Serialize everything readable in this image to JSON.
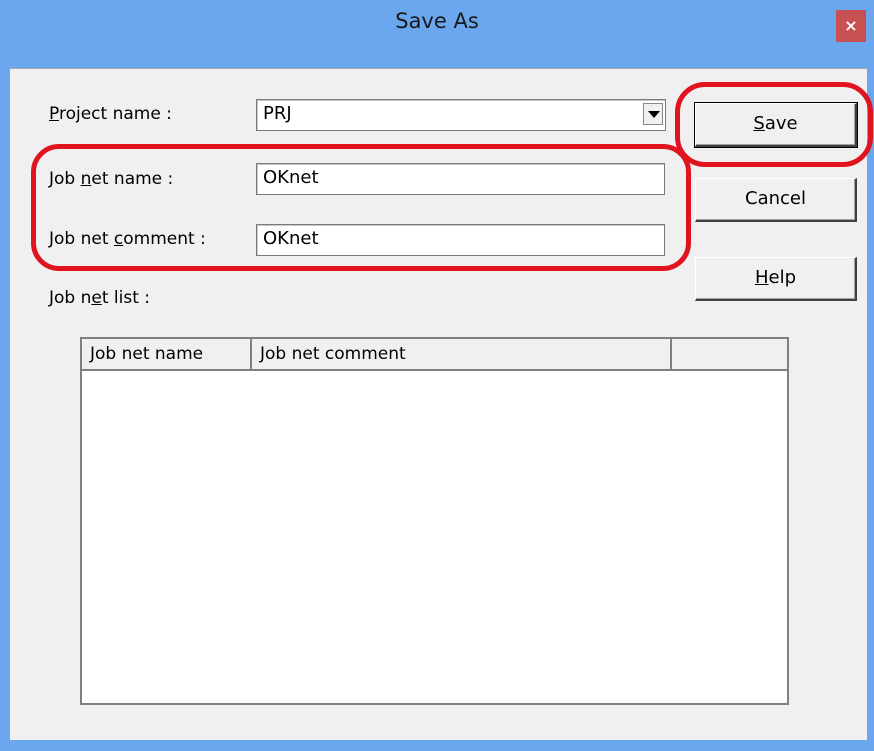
{
  "window": {
    "title": "Save As",
    "close_glyph": "×"
  },
  "form": {
    "project_name_label": "roject name :",
    "project_name_mnemonic": "P",
    "project_name_value": "PRJ",
    "job_net_name_label_pre": "Job ",
    "job_net_name_mnemonic": "n",
    "job_net_name_label_post": "et name :",
    "job_net_name_value": "OKnet",
    "job_net_comment_label_pre": "Job net ",
    "job_net_comment_mnemonic": "c",
    "job_net_comment_label_post": "omment :",
    "job_net_comment_value": "OKnet",
    "job_net_list_label_pre": "Job n",
    "job_net_list_mnemonic": "e",
    "job_net_list_label_post": "t list  :"
  },
  "buttons": {
    "save_mnemonic": "S",
    "save_rest": "ave",
    "cancel": "Cancel",
    "help_mnemonic": "H",
    "help_rest": "elp"
  },
  "list": {
    "columns": [
      "Job net name",
      "Job net comment",
      ""
    ],
    "rows": []
  },
  "annotation_color": "#e0141e",
  "icons": {
    "close": "close-icon",
    "dropdown": "chevron-down-icon"
  }
}
